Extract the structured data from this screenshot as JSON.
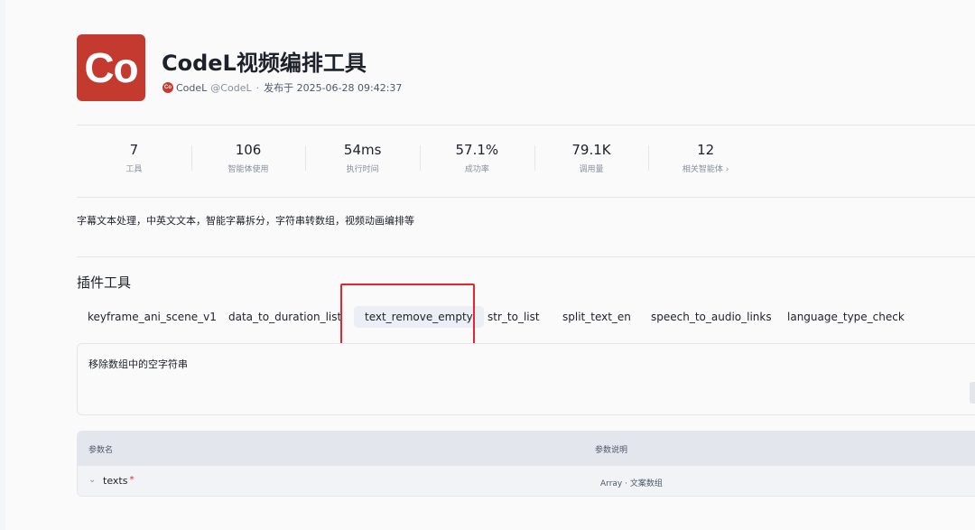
{
  "plugin": {
    "logo_text": "Co",
    "title": "CodeL视频编排工具",
    "author_logo_text": "Co",
    "author": "CodeL",
    "handle": "@CodeL",
    "published": "发布于 2025-06-28 09:42:37"
  },
  "stats": [
    {
      "value": "7",
      "label": "工具"
    },
    {
      "value": "106",
      "label": "智能体使用"
    },
    {
      "value": "54ms",
      "label": "执行时间"
    },
    {
      "value": "57.1%",
      "label": "成功率"
    },
    {
      "value": "79.1K",
      "label": "调用量"
    },
    {
      "value": "12",
      "label": "相关智能体"
    }
  ],
  "description": "字幕文本处理，中英文文本，智能字幕拆分，字符串转数组，视频动画编排等",
  "tools_section": {
    "title": "插件工具",
    "tabs": [
      {
        "label": "keyframe_ani_scene_v1",
        "active": false
      },
      {
        "label": "data_to_duration_list",
        "active": false
      },
      {
        "label": "text_remove_empty",
        "active": true
      },
      {
        "label": "str_to_list",
        "active": false
      },
      {
        "label": "split_text_en",
        "active": false
      },
      {
        "label": "speech_to_audio_links",
        "active": false
      },
      {
        "label": "language_type_check",
        "active": false
      }
    ],
    "tool_description": "移除数组中的空字符串"
  },
  "params_table": {
    "col_name": "参数名",
    "col_desc": "参数说明",
    "rows": [
      {
        "name": "texts",
        "required_mark": "*",
        "type_desc": "Array · 文案数组"
      }
    ]
  },
  "colors": {
    "logo_bg": "#c43a2f",
    "highlight": "#e5262c",
    "active_tab_bg": "#ebeef4"
  }
}
